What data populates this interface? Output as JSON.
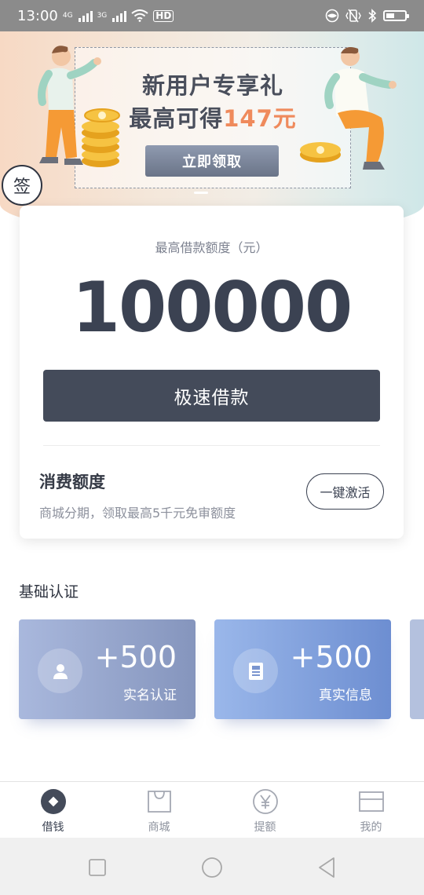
{
  "status_bar": {
    "time": "13:00",
    "net1": "4G",
    "net2": "3G",
    "hd": "HD"
  },
  "banner": {
    "title": "新用户专享礼",
    "subtitle_prefix": "最高可得",
    "subtitle_amount": "147元",
    "claim_button": "立即领取",
    "sign_badge": "签"
  },
  "credit": {
    "limit_label": "最高借款额度（元）",
    "limit_value": "100000",
    "borrow_button": "极速借款",
    "consume_title": "消费额度",
    "consume_desc": "商城分期，领取最高5千元免审额度",
    "activate_button": "一键激活"
  },
  "verification": {
    "title": "基础认证",
    "cards": [
      {
        "points": "+500",
        "name": "实名认证",
        "icon": "person-icon"
      },
      {
        "points": "+500",
        "name": "真实信息",
        "icon": "document-icon"
      }
    ]
  },
  "bottom_nav": [
    {
      "label": "借钱",
      "icon": "loan-icon",
      "active": true
    },
    {
      "label": "商城",
      "icon": "bag-icon",
      "active": false
    },
    {
      "label": "提额",
      "icon": "yen-icon",
      "active": false
    },
    {
      "label": "我的",
      "icon": "card-icon",
      "active": false
    }
  ],
  "colors": {
    "primary": "#444b5a",
    "accent": "#ef8a5c",
    "auth_card_1": "#8595bd",
    "auth_card_2": "#6d8ed1"
  }
}
